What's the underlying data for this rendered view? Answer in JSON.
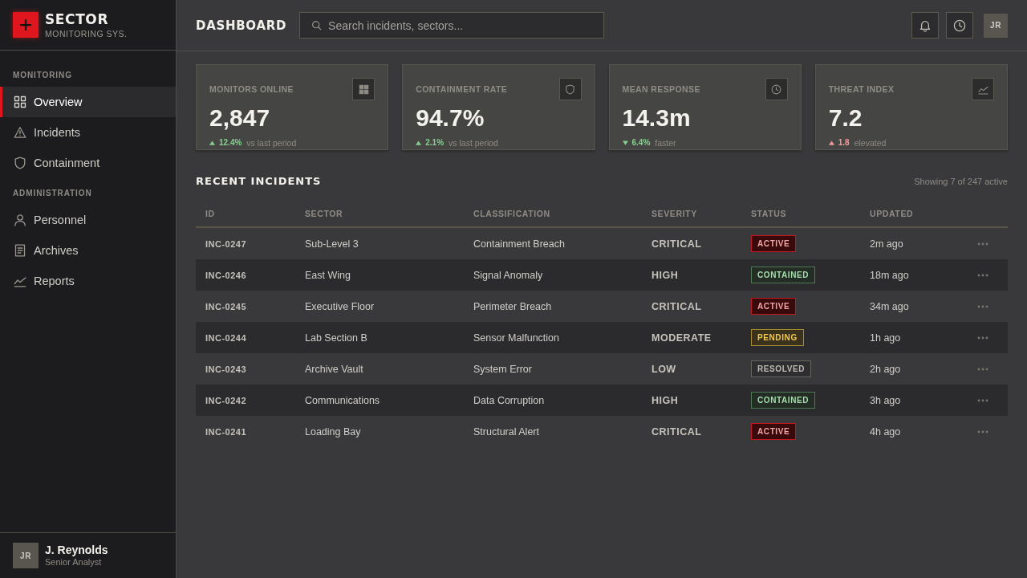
{
  "sidebar": {
    "brand": {
      "name": "SECTOR",
      "subtitle": "MONITORING SYS."
    },
    "sections": [
      {
        "label": "MONITORING",
        "items": [
          {
            "label": "Overview",
            "selected": true
          },
          {
            "label": "Incidents",
            "selected": false
          },
          {
            "label": "Containment",
            "selected": false
          }
        ]
      },
      {
        "label": "ADMINISTRATION",
        "items": [
          {
            "label": "Personnel",
            "selected": false
          },
          {
            "label": "Archives",
            "selected": false
          },
          {
            "label": "Reports",
            "selected": false
          }
        ]
      }
    ],
    "user": {
      "initials": "JR",
      "name": "J. Reynolds",
      "role": "Senior Analyst"
    }
  },
  "header": {
    "title": "DASHBOARD",
    "search": {
      "placeholder": "Search incidents, sectors..."
    },
    "avatar": "JR"
  },
  "stats": [
    {
      "label": "MONITORS ONLINE",
      "value": "2,847",
      "trend": {
        "rising": true,
        "color": "#86d08f",
        "change": "12.4%",
        "note": "vs last period"
      }
    },
    {
      "label": "CONTAINMENT RATE",
      "value": "94.7%",
      "trend": {
        "rising": true,
        "color": "#86d08f",
        "change": "2.1%",
        "note": "vs last period"
      }
    },
    {
      "label": "MEAN RESPONSE",
      "value": "14.3m",
      "trend": {
        "rising": false,
        "color": "#86d08f",
        "change": "6.4%",
        "note": "faster"
      }
    },
    {
      "label": "THREAT INDEX",
      "value": "7.2",
      "trend": {
        "rising": true,
        "color": "#f59a9a",
        "change": "1.8",
        "note": "elevated"
      }
    }
  ],
  "incidents": {
    "title": "RECENT INCIDENTS",
    "summary": "Showing 7 of 247 active",
    "columns": [
      "ID",
      "SECTOR",
      "CLASSIFICATION",
      "SEVERITY",
      "STATUS",
      "UPDATED"
    ],
    "rows": [
      {
        "id": "INC-0247",
        "sector": "Sub-Level 3",
        "classification": "Containment Breach",
        "severity": "CRITICAL",
        "status": {
          "label": "ACTIVE",
          "kind": "active"
        },
        "updated": "2m ago"
      },
      {
        "id": "INC-0246",
        "sector": "East Wing",
        "classification": "Signal Anomaly",
        "severity": "HIGH",
        "status": {
          "label": "CONTAINED",
          "kind": "contained"
        },
        "updated": "18m ago"
      },
      {
        "id": "INC-0245",
        "sector": "Executive Floor",
        "classification": "Perimeter Breach",
        "severity": "CRITICAL",
        "status": {
          "label": "ACTIVE",
          "kind": "active"
        },
        "updated": "34m ago"
      },
      {
        "id": "INC-0244",
        "sector": "Lab Section B",
        "classification": "Sensor Malfunction",
        "severity": "MODERATE",
        "status": {
          "label": "PENDING",
          "kind": "pending"
        },
        "updated": "1h ago"
      },
      {
        "id": "INC-0243",
        "sector": "Archive Vault",
        "classification": "System Error",
        "severity": "LOW",
        "status": {
          "label": "RESOLVED",
          "kind": "resolved"
        },
        "updated": "2h ago"
      },
      {
        "id": "INC-0242",
        "sector": "Communications",
        "classification": "Data Corruption",
        "severity": "HIGH",
        "status": {
          "label": "CONTAINED",
          "kind": "contained"
        },
        "updated": "3h ago"
      },
      {
        "id": "INC-0241",
        "sector": "Loading Bay",
        "classification": "Structural Alert",
        "severity": "CRITICAL",
        "status": {
          "label": "ACTIVE",
          "kind": "active"
        },
        "updated": "4h ago"
      }
    ]
  }
}
